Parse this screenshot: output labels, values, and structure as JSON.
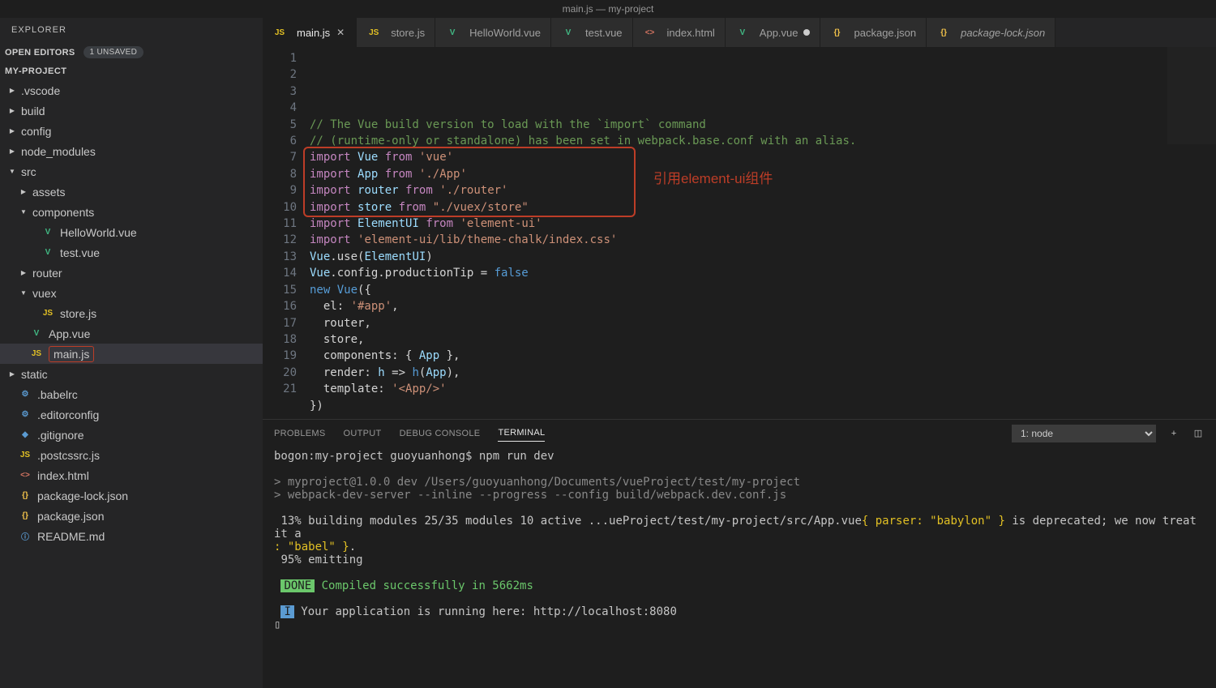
{
  "titlebar": "main.js — my-project",
  "explorer": {
    "header": "EXPLORER"
  },
  "open_editors": {
    "label": "OPEN EDITORS",
    "badge": "1 UNSAVED"
  },
  "project": {
    "name": "MY-PROJECT"
  },
  "tree": [
    {
      "indent": 0,
      "arrow": "right",
      "icon": "",
      "icontype": "",
      "label": ".vscode"
    },
    {
      "indent": 0,
      "arrow": "right",
      "icon": "",
      "icontype": "",
      "label": "build"
    },
    {
      "indent": 0,
      "arrow": "right",
      "icon": "",
      "icontype": "",
      "label": "config"
    },
    {
      "indent": 0,
      "arrow": "right",
      "icon": "",
      "icontype": "",
      "label": "node_modules"
    },
    {
      "indent": 0,
      "arrow": "down",
      "icon": "",
      "icontype": "",
      "label": "src"
    },
    {
      "indent": 1,
      "arrow": "right",
      "icon": "",
      "icontype": "",
      "label": "assets"
    },
    {
      "indent": 1,
      "arrow": "down",
      "icon": "",
      "icontype": "",
      "label": "components"
    },
    {
      "indent": 2,
      "arrow": "blank",
      "icon": "V",
      "icontype": "vue",
      "label": "HelloWorld.vue"
    },
    {
      "indent": 2,
      "arrow": "blank",
      "icon": "V",
      "icontype": "vue",
      "label": "test.vue"
    },
    {
      "indent": 1,
      "arrow": "right",
      "icon": "",
      "icontype": "",
      "label": "router"
    },
    {
      "indent": 1,
      "arrow": "down",
      "icon": "",
      "icontype": "",
      "label": "vuex"
    },
    {
      "indent": 2,
      "arrow": "blank",
      "icon": "JS",
      "icontype": "js",
      "label": "store.js"
    },
    {
      "indent": 1,
      "arrow": "blank",
      "icon": "V",
      "icontype": "vue",
      "label": "App.vue"
    },
    {
      "indent": 1,
      "arrow": "blank",
      "icon": "JS",
      "icontype": "js",
      "label": "main.js",
      "active": true
    },
    {
      "indent": 0,
      "arrow": "right",
      "icon": "",
      "icontype": "",
      "label": "static"
    },
    {
      "indent": 0,
      "arrow": "blank",
      "icon": "⚙",
      "icontype": "info",
      "label": ".babelrc"
    },
    {
      "indent": 0,
      "arrow": "blank",
      "icon": "⚙",
      "icontype": "info",
      "label": ".editorconfig"
    },
    {
      "indent": 0,
      "arrow": "blank",
      "icon": "◆",
      "icontype": "info",
      "label": ".gitignore"
    },
    {
      "indent": 0,
      "arrow": "blank",
      "icon": "JS",
      "icontype": "js",
      "label": ".postcssrc.js"
    },
    {
      "indent": 0,
      "arrow": "blank",
      "icon": "<>",
      "icontype": "html",
      "label": "index.html"
    },
    {
      "indent": 0,
      "arrow": "blank",
      "icon": "{}",
      "icontype": "json",
      "label": "package-lock.json"
    },
    {
      "indent": 0,
      "arrow": "blank",
      "icon": "{}",
      "icontype": "json",
      "label": "package.json"
    },
    {
      "indent": 0,
      "arrow": "blank",
      "icon": "ⓘ",
      "icontype": "info",
      "label": "README.md"
    }
  ],
  "tabs": [
    {
      "icon": "JS",
      "icontype": "js",
      "label": "main.js",
      "active": true,
      "close": true
    },
    {
      "icon": "JS",
      "icontype": "js",
      "label": "store.js"
    },
    {
      "icon": "V",
      "icontype": "vue",
      "label": "HelloWorld.vue"
    },
    {
      "icon": "V",
      "icontype": "vue",
      "label": "test.vue"
    },
    {
      "icon": "<>",
      "icontype": "html",
      "label": "index.html"
    },
    {
      "icon": "V",
      "icontype": "vue",
      "label": "App.vue",
      "dirty": true
    },
    {
      "icon": "{}",
      "icontype": "json",
      "label": "package.json"
    },
    {
      "icon": "{}",
      "icontype": "json",
      "label": "package-lock.json",
      "italic": true
    }
  ],
  "code_lines": [
    [
      {
        "c": "c-cmt",
        "t": "// The Vue build version to load with the `import` command"
      }
    ],
    [
      {
        "c": "c-cmt",
        "t": "// (runtime-only or standalone) has been set in webpack.base.conf with an alias."
      }
    ],
    [
      {
        "c": "c-kw",
        "t": "import"
      },
      {
        "c": "c-def",
        "t": " "
      },
      {
        "c": "c-id",
        "t": "Vue"
      },
      {
        "c": "c-def",
        "t": " "
      },
      {
        "c": "c-kw",
        "t": "from"
      },
      {
        "c": "c-def",
        "t": " "
      },
      {
        "c": "c-str",
        "t": "'vue'"
      }
    ],
    [
      {
        "c": "c-kw",
        "t": "import"
      },
      {
        "c": "c-def",
        "t": " "
      },
      {
        "c": "c-id",
        "t": "App"
      },
      {
        "c": "c-def",
        "t": " "
      },
      {
        "c": "c-kw",
        "t": "from"
      },
      {
        "c": "c-def",
        "t": " "
      },
      {
        "c": "c-str",
        "t": "'./App'"
      }
    ],
    [
      {
        "c": "c-kw",
        "t": "import"
      },
      {
        "c": "c-def",
        "t": " "
      },
      {
        "c": "c-id",
        "t": "router"
      },
      {
        "c": "c-def",
        "t": " "
      },
      {
        "c": "c-kw",
        "t": "from"
      },
      {
        "c": "c-def",
        "t": " "
      },
      {
        "c": "c-str",
        "t": "'./router'"
      }
    ],
    [
      {
        "c": "c-kw",
        "t": "import"
      },
      {
        "c": "c-def",
        "t": " "
      },
      {
        "c": "c-id",
        "t": "store"
      },
      {
        "c": "c-def",
        "t": " "
      },
      {
        "c": "c-kw",
        "t": "from"
      },
      {
        "c": "c-def",
        "t": " "
      },
      {
        "c": "c-str",
        "t": "\"./vuex/store\""
      }
    ],
    [
      {
        "c": "c-kw",
        "t": "import"
      },
      {
        "c": "c-def",
        "t": " "
      },
      {
        "c": "c-id",
        "t": "ElementUI"
      },
      {
        "c": "c-def",
        "t": " "
      },
      {
        "c": "c-kw",
        "t": "from"
      },
      {
        "c": "c-def",
        "t": " "
      },
      {
        "c": "c-str",
        "t": "'element-ui'"
      }
    ],
    [
      {
        "c": "c-kw",
        "t": "import"
      },
      {
        "c": "c-def",
        "t": " "
      },
      {
        "c": "c-str",
        "t": "'element-ui/lib/theme-chalk/index.css'"
      }
    ],
    [
      {
        "c": "c-def",
        "t": ""
      }
    ],
    [
      {
        "c": "c-id",
        "t": "Vue"
      },
      {
        "c": "c-def",
        "t": ".use("
      },
      {
        "c": "c-id",
        "t": "ElementUI"
      },
      {
        "c": "c-def",
        "t": ")"
      }
    ],
    [
      {
        "c": "c-def",
        "t": ""
      }
    ],
    [
      {
        "c": "c-id",
        "t": "Vue"
      },
      {
        "c": "c-def",
        "t": ".config.productionTip = "
      },
      {
        "c": "c-bool",
        "t": "false"
      }
    ],
    [
      {
        "c": "c-def",
        "t": ""
      }
    ],
    [
      {
        "c": "c-new",
        "t": "new"
      },
      {
        "c": "c-def",
        "t": " "
      },
      {
        "c": "c-fn",
        "t": "Vue"
      },
      {
        "c": "c-def",
        "t": "({"
      }
    ],
    [
      {
        "c": "c-def",
        "t": "  el: "
      },
      {
        "c": "c-str",
        "t": "'#app'"
      },
      {
        "c": "c-def",
        "t": ","
      }
    ],
    [
      {
        "c": "c-def",
        "t": "  router,"
      }
    ],
    [
      {
        "c": "c-def",
        "t": "  store,"
      }
    ],
    [
      {
        "c": "c-def",
        "t": "  components: { "
      },
      {
        "c": "c-id",
        "t": "App"
      },
      {
        "c": "c-def",
        "t": " },"
      }
    ],
    [
      {
        "c": "c-def",
        "t": "  render: "
      },
      {
        "c": "c-id",
        "t": "h"
      },
      {
        "c": "c-def",
        "t": " => "
      },
      {
        "c": "c-fn",
        "t": "h"
      },
      {
        "c": "c-def",
        "t": "("
      },
      {
        "c": "c-id",
        "t": "App"
      },
      {
        "c": "c-def",
        "t": "),"
      }
    ],
    [
      {
        "c": "c-def",
        "t": "  template: "
      },
      {
        "c": "c-str",
        "t": "'<App/>'"
      }
    ],
    [
      {
        "c": "c-def",
        "t": "})"
      }
    ]
  ],
  "annotation": "引用element-ui组件",
  "panel": {
    "tabs": {
      "problems": "PROBLEMS",
      "output": "OUTPUT",
      "debug": "DEBUG CONSOLE",
      "terminal": "TERMINAL"
    },
    "select": "1: node"
  },
  "terminal": {
    "line1": "bogon:my-project guoyuanhong$ npm run dev",
    "line2": "",
    "line3": "> myproject@1.0.0 dev /Users/guoyuanhong/Documents/vueProject/test/my-project",
    "line4": "> webpack-dev-server --inline --progress --config build/webpack.dev.conf.js",
    "line5": "",
    "line6a": " 13% building modules 25/35 modules 10 active ...ueProject/test/my-project/src/App.vue",
    "line6b": "{ parser: \"babylon\" }",
    "line6c": " is deprecated; we now treat it a",
    "line6d": ": \"babel\" }",
    "line6e": ".",
    "line7": " 95% emitting",
    "line8": "",
    "done_badge": "DONE",
    "done_msg": " Compiled successfully in 5662ms",
    "line9": "",
    "i_badge": "I",
    "running": " Your application is running here: http://localhost:8080",
    "cursor": "▯"
  }
}
